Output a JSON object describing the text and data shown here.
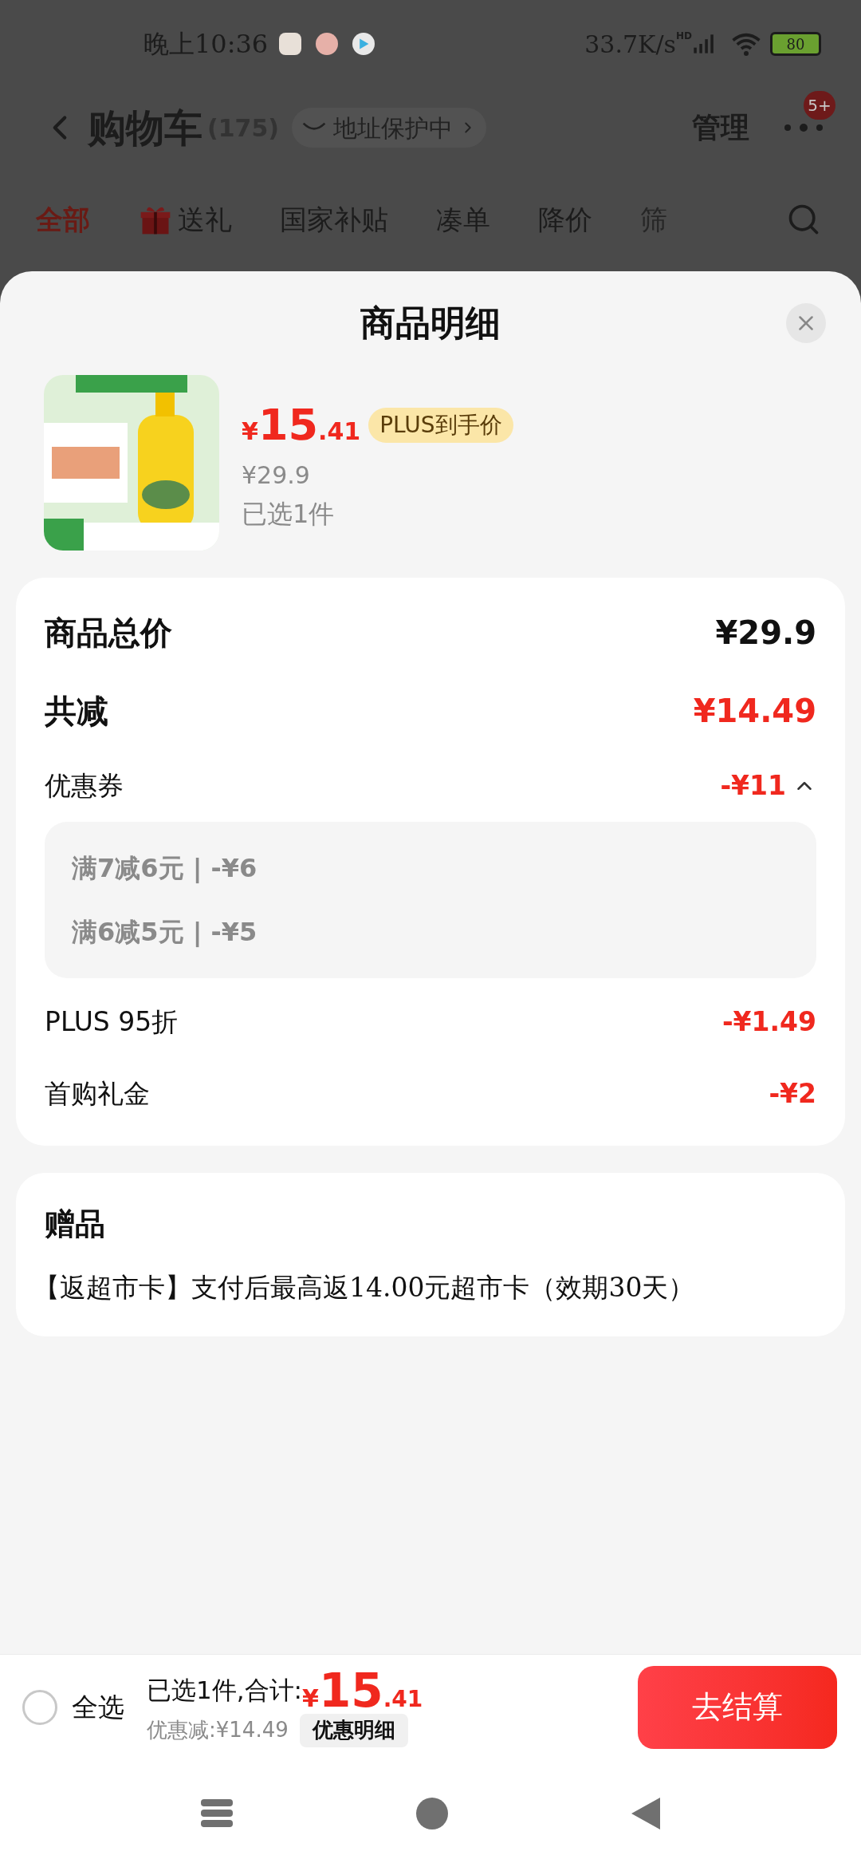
{
  "status_bar": {
    "time": "晚上10:36",
    "speed": "33.7K/s",
    "network": "HD",
    "battery": "80"
  },
  "header": {
    "title": "购物车",
    "count": "(175)",
    "address_badge": "地址保护中",
    "manage": "管理",
    "badge": "5+"
  },
  "tabs": [
    {
      "label": "全部",
      "selected": true,
      "kind": "text"
    },
    {
      "label": "送礼",
      "selected": false,
      "kind": "gift"
    },
    {
      "label": "国家补贴",
      "selected": false,
      "kind": "text"
    },
    {
      "label": "凑单",
      "selected": false,
      "kind": "text"
    },
    {
      "label": "降价",
      "selected": false,
      "kind": "text"
    },
    {
      "label": "筛",
      "selected": false,
      "kind": "faded"
    }
  ],
  "sheet": {
    "title": "商品明细",
    "product": {
      "price": {
        "symbol": "¥",
        "integer": "15",
        "decimal": ".41"
      },
      "tag": "PLUS到手价",
      "original_price": "¥29.9",
      "selected_count": "已选1件"
    },
    "rows": [
      {
        "kind": "major",
        "label": "商品总价",
        "value": "¥29.9",
        "emphasis": false
      },
      {
        "kind": "major",
        "label": "共减",
        "value": "¥14.49",
        "emphasis": true
      },
      {
        "kind": "minor",
        "label": "优惠券",
        "value": "-¥11",
        "emphasis": true,
        "expanded": true,
        "details": [
          "满7减6元 | -¥6",
          "满6减5元 | -¥5"
        ]
      },
      {
        "kind": "minor",
        "label": "PLUS 95折",
        "value": "-¥1.49",
        "emphasis": true
      },
      {
        "kind": "minor",
        "label": "首购礼金",
        "value": "-¥2",
        "emphasis": true
      }
    ],
    "gift": {
      "title": "赠品",
      "text": "【返超市卡】支付后最高返14.00元超市卡（效期30天）"
    }
  },
  "bottom_bar": {
    "select_all": {
      "label": "全选",
      "checked": false
    },
    "summary": "已选1件,合计:",
    "total": {
      "symbol": "¥",
      "integer": "15",
      "decimal": ".41"
    },
    "discount": "优惠减:¥14.49",
    "details_button": "优惠明细",
    "checkout": "去结算"
  }
}
